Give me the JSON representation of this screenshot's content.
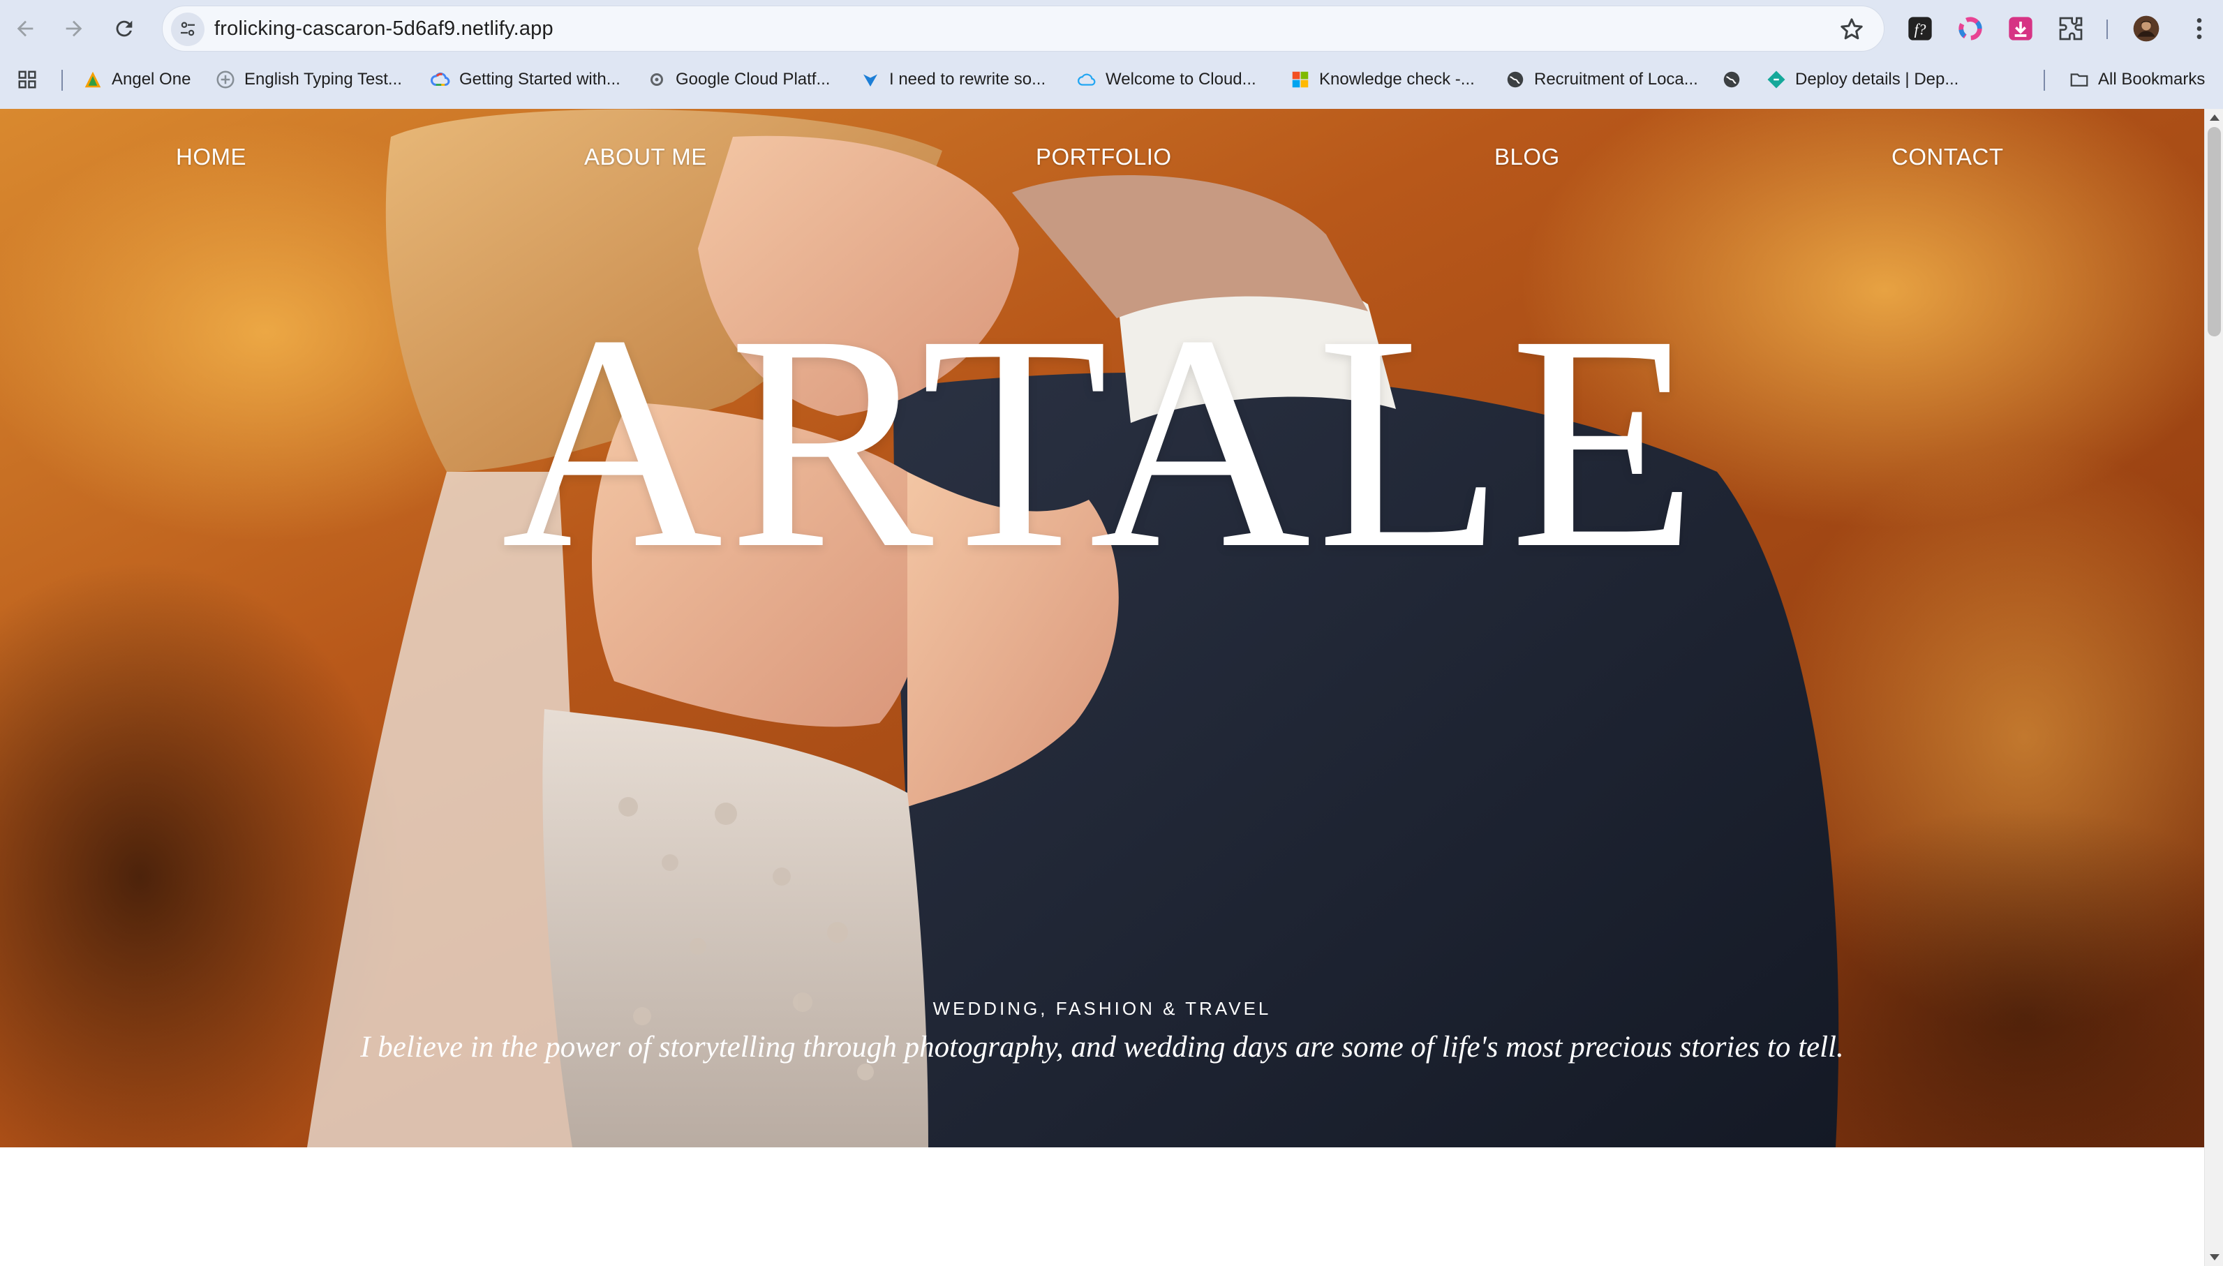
{
  "browser": {
    "url": "frolicking-cascaron-5d6af9.netlify.app",
    "icons": {
      "back": "back-arrow-icon",
      "forward": "forward-arrow-icon",
      "reload": "reload-icon",
      "site_info": "tune-icon",
      "bookmark_star": "star-icon",
      "menu": "kebab-menu-icon"
    },
    "bookmarks": [
      {
        "label": "Angel One",
        "icon": "angel-one-icon"
      },
      {
        "label": "English Typing Test...",
        "icon": "typing-icon"
      },
      {
        "label": "Getting Started with...",
        "icon": "google-cloud-icon"
      },
      {
        "label": "Google Cloud Platf...",
        "icon": "gear-icon"
      },
      {
        "label": "I need to rewrite so...",
        "icon": "ai-icon"
      },
      {
        "label": "Welcome to Cloud...",
        "icon": "cloud-icon"
      },
      {
        "label": "Knowledge check -...",
        "icon": "microsoft-icon"
      },
      {
        "label": "Recruitment of Loca...",
        "icon": "globe-icon"
      },
      {
        "label": "",
        "icon": "globe-icon"
      },
      {
        "label": "Deploy details | Dep...",
        "icon": "netlify-icon"
      }
    ],
    "all_bookmarks": "All Bookmarks"
  },
  "site": {
    "nav": [
      "HOME",
      "ABOUT ME",
      "PORTFOLIO",
      "BLOG",
      "CONTACT"
    ],
    "brand": "ARTALE",
    "tagline": "WEDDING, FASHION & TRAVEL",
    "subtitle": "I believe in the power of storytelling through photography, and wedding days are some of life's most precious stories to tell."
  },
  "colors": {
    "chrome_bg": "#dfe6f3",
    "hero_autumn": "#c4611e",
    "suit": "#1c2230",
    "text_on_hero": "#ffffff"
  }
}
